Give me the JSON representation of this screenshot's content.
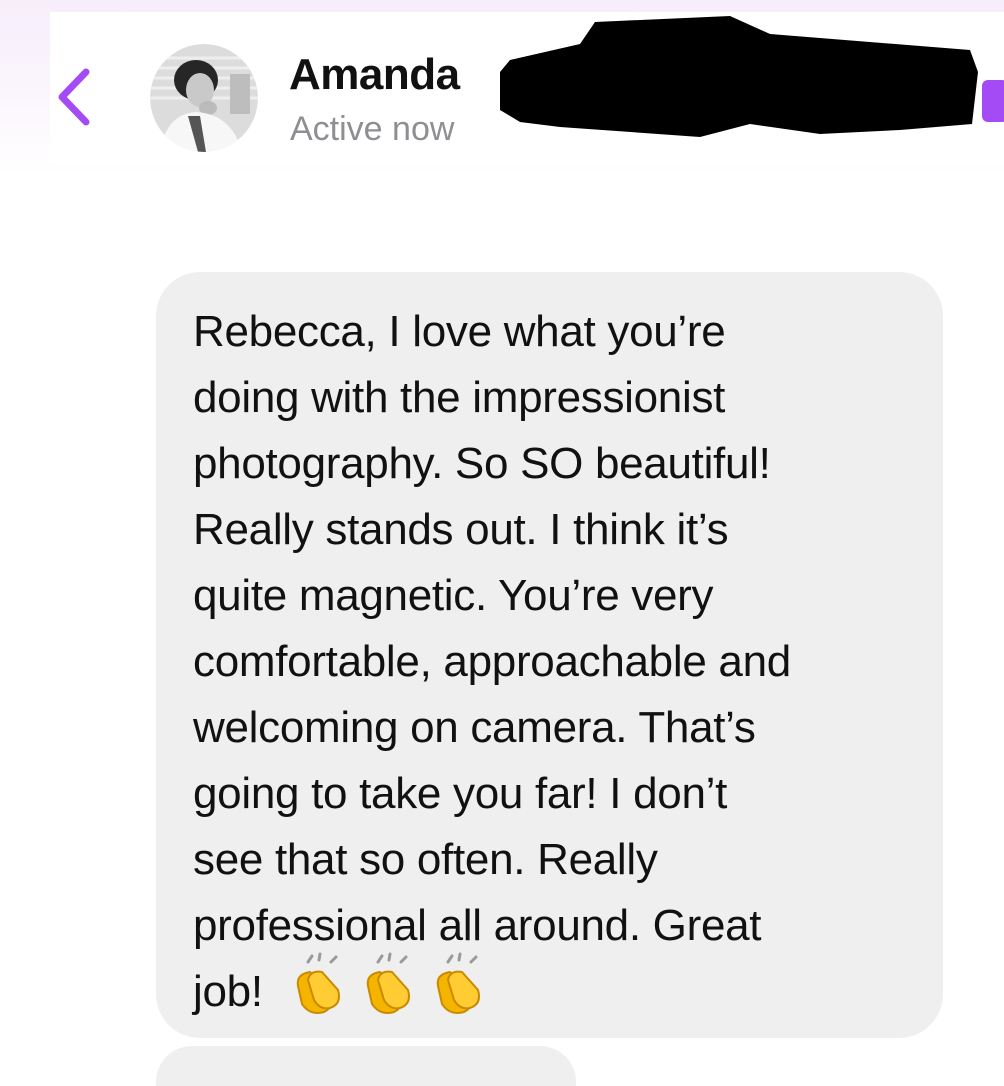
{
  "header": {
    "contact_name": "Amanda",
    "status": "Active now",
    "back_icon": "chevron-left-icon",
    "avatar_icon": "profile-photo"
  },
  "message": {
    "text": "Rebecca, I love what you’re\ndoing with the impressionist\nphotography. So SO beautiful!\nReally stands out. I think it’s\nquite magnetic. You’re very\ncomfortable, approachable and\nwelcoming on camera. That’s\ngoing to take you far! I don’t\nsee that so often. Really\nprofessional all around. Great\njob!",
    "emojis": [
      "clapping-hands-icon",
      "clapping-hands-icon",
      "clapping-hands-icon"
    ]
  },
  "colors": {
    "accent": "#a44bf5",
    "bubble": "#efeff0",
    "status": "#8e8e93"
  }
}
